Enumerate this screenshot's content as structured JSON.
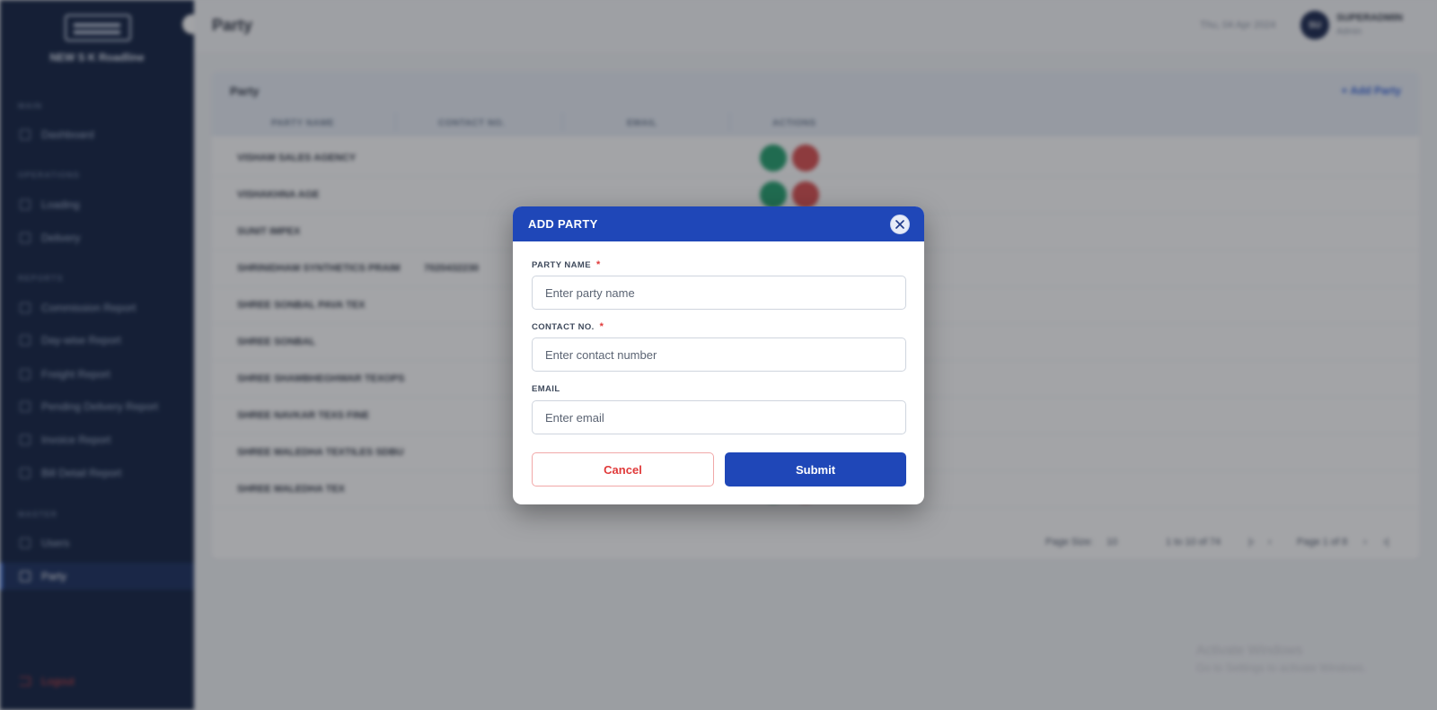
{
  "sidebar": {
    "brand_name": "NEW S K Roadline",
    "sections": [
      {
        "label": "MAIN"
      },
      {
        "label": "OPERATIONS"
      },
      {
        "label": "REPORTS"
      },
      {
        "label": "MASTER"
      }
    ],
    "items": [
      {
        "label": "Dashboard",
        "icon": "dashboard-icon"
      },
      {
        "label": "Loading",
        "icon": "truck-icon"
      },
      {
        "label": "Delivery",
        "icon": "package-icon"
      },
      {
        "label": "Commission Report",
        "icon": "report-icon"
      },
      {
        "label": "Day-wise Report",
        "icon": "calendar-icon"
      },
      {
        "label": "Freight Report",
        "icon": "rupee-icon"
      },
      {
        "label": "Pending Delivery Report",
        "icon": "clock-icon"
      },
      {
        "label": "Invoice Report",
        "icon": "invoice-icon"
      },
      {
        "label": "Bill Detail Report",
        "icon": "bill-icon"
      },
      {
        "label": "Users",
        "icon": "users-icon"
      },
      {
        "label": "Party",
        "icon": "user-icon",
        "active": true
      }
    ],
    "logout_label": "Logout"
  },
  "topbar": {
    "page_title": "Party",
    "date": "Thu, 04 Apr 2024",
    "avatar_initials": "SU",
    "user_name": "SUPERADMIN",
    "user_role": "Admin"
  },
  "table": {
    "title": "Party",
    "add_label": "+ Add Party",
    "columns": [
      "PARTY NAME",
      "CONTACT NO.",
      "EMAIL",
      "ACTIONS"
    ],
    "rows": [
      {
        "name": "VISHAM SALES AGENCY",
        "contact": ""
      },
      {
        "name": "VISHAKHNA AGE",
        "contact": ""
      },
      {
        "name": "SUNIT IMPEX",
        "contact": ""
      },
      {
        "name": "SHRINIDHAM SYNTHETICS PRAIM",
        "contact": "7020432230"
      },
      {
        "name": "SHREE SONBAL PAVA TEX",
        "contact": ""
      },
      {
        "name": "SHREE SONBAL",
        "contact": ""
      },
      {
        "name": "SHREE SHAMBHEGHWAR TEXOPS",
        "contact": ""
      },
      {
        "name": "SHREE NAVKAR TEXS FINE",
        "contact": ""
      },
      {
        "name": "SHREE MALEDHA TEXTILES SDBU",
        "contact": ""
      },
      {
        "name": "SHREE MALEDHA TEX",
        "contact": ""
      }
    ],
    "pager": {
      "page_size_label": "Page Size:",
      "page_size": "10",
      "range": "1 to 10 of 74",
      "page_label": "Page 1 of 8"
    }
  },
  "watermark": {
    "line1": "Activate Windows",
    "line2": "Go to Settings to activate Windows."
  },
  "modal": {
    "title": "ADD PARTY",
    "fields": {
      "party_name": {
        "label": "PARTY NAME",
        "required_mark": "*",
        "value": "",
        "placeholder": "Enter party name"
      },
      "contact": {
        "label": "CONTACT NO.",
        "required_mark": "*",
        "value": "",
        "placeholder": "Enter contact number"
      },
      "email": {
        "label": "EMAIL",
        "value": "",
        "placeholder": "Enter email"
      }
    },
    "cancel_label": "Cancel",
    "submit_label": "Submit"
  },
  "colors": {
    "primary": "#1f47b8",
    "danger": "#e03a3a",
    "sidebar_bg": "#0b1b3d",
    "edit_green": "#1e9e6a",
    "delete_red": "#d94a4a"
  }
}
